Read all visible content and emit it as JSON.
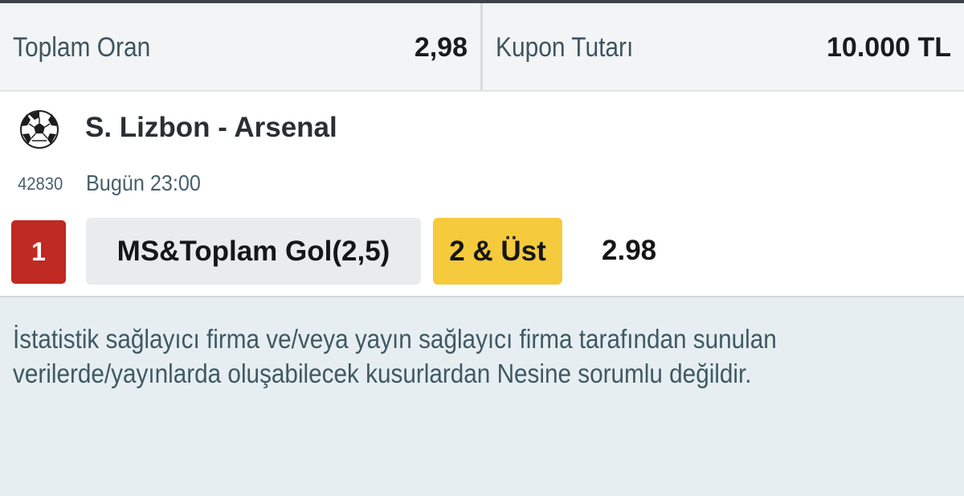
{
  "summary": {
    "total_odds_label": "Toplam Oran",
    "total_odds_value": "2,98",
    "coupon_amount_label": "Kupon Tutarı",
    "coupon_amount_value": "10.000 TL"
  },
  "event": {
    "sport_icon": "soccer-ball-icon",
    "match_name": "S. Lizbon - Arsenal",
    "event_code": "42830",
    "event_time": "Bugün 23:00",
    "mbs": "1",
    "market": "MS&Toplam Gol(2,5)",
    "selection": "2 & Üst",
    "odd": "2.98"
  },
  "disclaimer": {
    "line1": "İstatistik sağlayıcı firma ve/veya yayın sağlayıcı firma tarafından sunulan",
    "line2": "verilerde/yayınlarda oluşabilecek kusurlardan Nesine sorumlu değildir."
  },
  "colors": {
    "mbs_badge": "#bf2a22",
    "selection_highlight": "#f5ca3c",
    "market_box": "#e9ebec",
    "disclaimer_background": "#e6eef1"
  }
}
